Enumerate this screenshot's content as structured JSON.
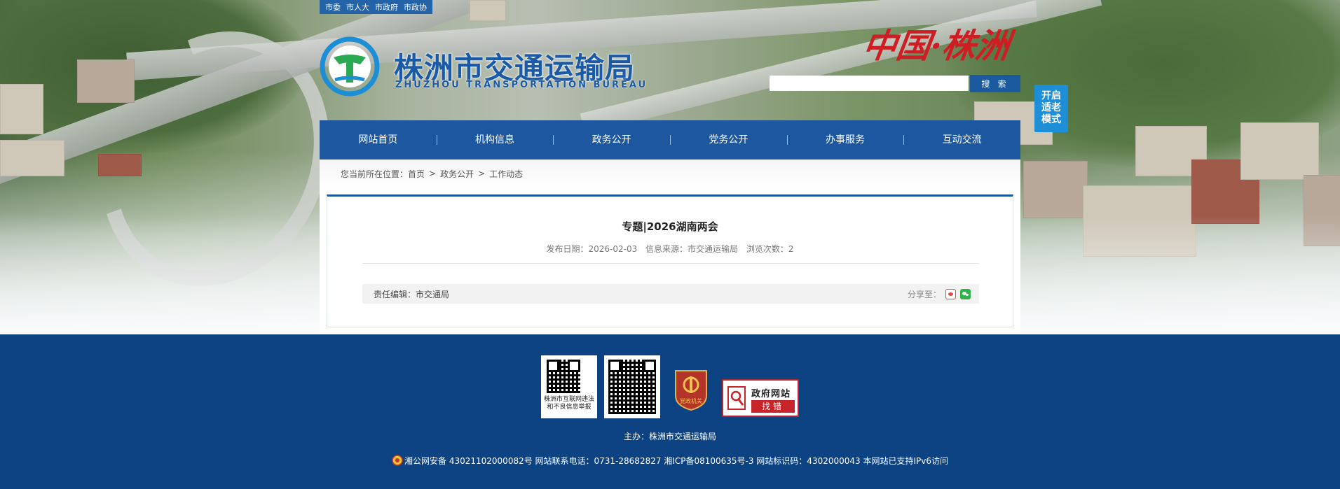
{
  "top_links": [
    "市委",
    "市人大",
    "市政府",
    "市政协"
  ],
  "logo": {
    "title_cn": "株洲市交通运输局",
    "title_en": "ZHUZHOU TRANSPORTATION BUREAU"
  },
  "slogan": "中国·株洲",
  "search": {
    "placeholder": "",
    "button_label": "搜 索"
  },
  "elder_mode_label": "开启适老模式",
  "nav": {
    "items": [
      "网站首页",
      "机构信息",
      "政务公开",
      "党务公开",
      "办事服务",
      "互动交流"
    ]
  },
  "breadcrumb": {
    "prefix": "您当前所在位置：",
    "items": [
      "首页",
      "政务公开",
      "工作动态"
    ],
    "separator": ">"
  },
  "article": {
    "title": "专题|2026湖南两会",
    "publish_date_label": "发布日期：2026-02-03",
    "source_label": "信息来源：市交通运输局",
    "views_label": "浏览次数：2",
    "editor_label": "责任编辑：市交通局",
    "share_label": "分享至："
  },
  "footer": {
    "qr1_caption": "株洲市互联网违法和不良信息举报",
    "party_badge_text": "党政机关",
    "gov_find_title": "政府网站",
    "gov_find_button": "找错",
    "sponsor": "主办：株洲市交通运输局",
    "record": "湘公网安备 43021102000082号 网站联系电话：0731-28682827 湘ICP备08100635号-3 网站标识码：4302000043 本网站已支持IPv6访问"
  },
  "colors": {
    "nav_blue": "#1c57a0",
    "footer_blue": "#0d4283",
    "elder_blue": "#1e8fd6",
    "slogan_red": "#cf1d24"
  }
}
